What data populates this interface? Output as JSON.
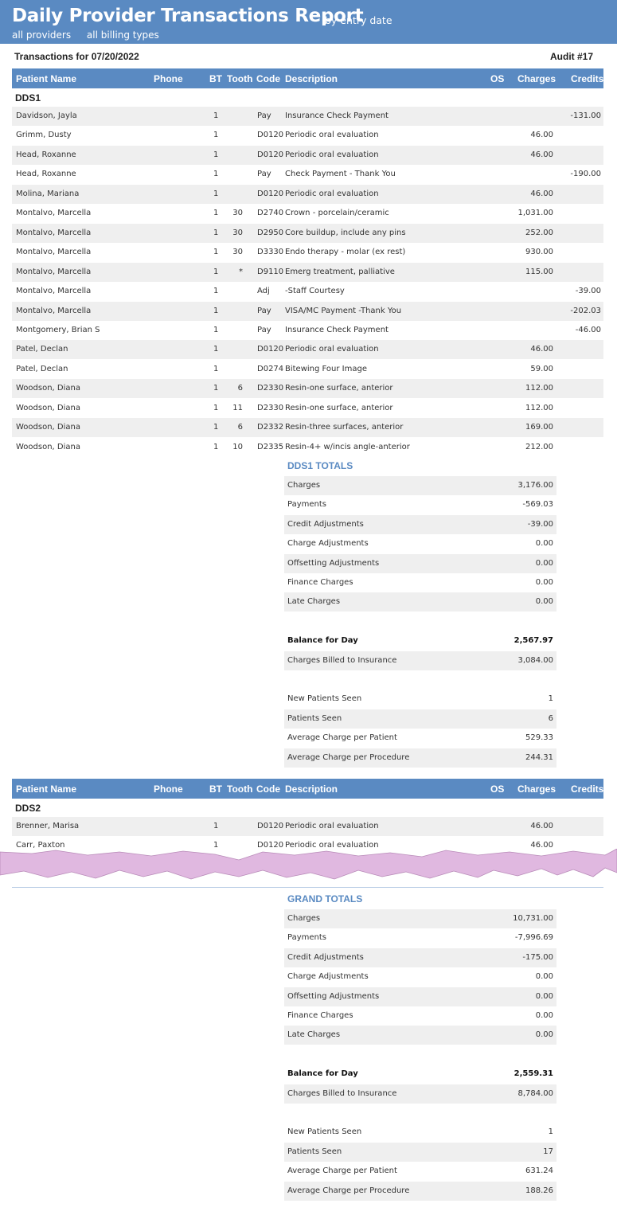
{
  "banner": {
    "title": "Daily Provider Transactions Report",
    "subtitle": "by entry date",
    "filter_providers": "all providers",
    "filter_billing": "all billing types"
  },
  "report": {
    "transactions_for": "Transactions for 07/20/2022",
    "audit": "Audit #17"
  },
  "columns": [
    "Patient Name",
    "Phone",
    "BT",
    "Tooth",
    "Code",
    "Description",
    "OS",
    "Charges",
    "Credits"
  ],
  "providers": [
    {
      "name": "DDS1",
      "rows": [
        {
          "name": "Davidson, Jayla",
          "bt": "1",
          "tooth": "",
          "code": "Pay",
          "desc": "Insurance Check Payment",
          "charges": "",
          "credits": "-131.00"
        },
        {
          "name": "Grimm, Dusty",
          "bt": "1",
          "tooth": "",
          "code": "D0120",
          "desc": "Periodic oral evaluation",
          "charges": "46.00",
          "credits": ""
        },
        {
          "name": "Head, Roxanne",
          "bt": "1",
          "tooth": "",
          "code": "D0120",
          "desc": "Periodic oral evaluation",
          "charges": "46.00",
          "credits": ""
        },
        {
          "name": "Head, Roxanne",
          "bt": "1",
          "tooth": "",
          "code": "Pay",
          "desc": "Check Payment - Thank You",
          "charges": "",
          "credits": "-190.00"
        },
        {
          "name": "Molina, Mariana",
          "bt": "1",
          "tooth": "",
          "code": "D0120",
          "desc": "Periodic oral evaluation",
          "charges": "46.00",
          "credits": ""
        },
        {
          "name": "Montalvo, Marcella",
          "bt": "1",
          "tooth": "30",
          "code": "D2740",
          "desc": "Crown - porcelain/ceramic",
          "charges": "1,031.00",
          "credits": ""
        },
        {
          "name": "Montalvo, Marcella",
          "bt": "1",
          "tooth": "30",
          "code": "D2950",
          "desc": "Core buildup, include any pins",
          "charges": "252.00",
          "credits": ""
        },
        {
          "name": "Montalvo, Marcella",
          "bt": "1",
          "tooth": "30",
          "code": "D3330",
          "desc": "Endo therapy - molar (ex rest)",
          "charges": "930.00",
          "credits": ""
        },
        {
          "name": "Montalvo, Marcella",
          "bt": "1",
          "tooth": "*",
          "code": "D9110",
          "desc": "Emerg treatment, palliative",
          "charges": "115.00",
          "credits": ""
        },
        {
          "name": "Montalvo, Marcella",
          "bt": "1",
          "tooth": "",
          "code": "Adj",
          "desc": "-Staff Courtesy",
          "charges": "",
          "credits": "-39.00"
        },
        {
          "name": "Montalvo, Marcella",
          "bt": "1",
          "tooth": "",
          "code": "Pay",
          "desc": "VISA/MC Payment -Thank You",
          "charges": "",
          "credits": "-202.03"
        },
        {
          "name": "Montgomery, Brian S",
          "bt": "1",
          "tooth": "",
          "code": "Pay",
          "desc": "Insurance Check Payment",
          "charges": "",
          "credits": "-46.00"
        },
        {
          "name": "Patel, Declan",
          "bt": "1",
          "tooth": "",
          "code": "D0120",
          "desc": "Periodic oral evaluation",
          "charges": "46.00",
          "credits": ""
        },
        {
          "name": "Patel, Declan",
          "bt": "1",
          "tooth": "",
          "code": "D0274",
          "desc": "Bitewing Four Image",
          "charges": "59.00",
          "credits": ""
        },
        {
          "name": "Woodson, Diana",
          "bt": "1",
          "tooth": "6",
          "code": "D2330",
          "desc": "Resin-one surface, anterior",
          "charges": "112.00",
          "credits": ""
        },
        {
          "name": "Woodson, Diana",
          "bt": "1",
          "tooth": "11",
          "code": "D2330",
          "desc": "Resin-one surface, anterior",
          "charges": "112.00",
          "credits": ""
        },
        {
          "name": "Woodson, Diana",
          "bt": "1",
          "tooth": "6",
          "code": "D2332",
          "desc": "Resin-three surfaces, anterior",
          "charges": "169.00",
          "credits": ""
        },
        {
          "name": "Woodson, Diana",
          "bt": "1",
          "tooth": "10",
          "code": "D2335",
          "desc": "Resin-4+ w/incis angle-anterior",
          "charges": "212.00",
          "credits": ""
        }
      ],
      "totals_title": "DDS1  TOTALS",
      "totals": {
        "charges": {
          "label": "Charges",
          "value": "3,176.00"
        },
        "payments": {
          "label": "Payments",
          "value": "-569.03"
        },
        "credit_adj": {
          "label": "Credit Adjustments",
          "value": "-39.00"
        },
        "charge_adj": {
          "label": "Charge Adjustments",
          "value": "0.00"
        },
        "offset_adj": {
          "label": "Offsetting Adjustments",
          "value": "0.00"
        },
        "finance": {
          "label": "Finance Charges",
          "value": "0.00"
        },
        "late": {
          "label": "Late Charges",
          "value": "0.00"
        },
        "balance": {
          "label": "Balance for Day",
          "value": "2,567.97"
        },
        "billed_ins": {
          "label": "Charges Billed to Insurance",
          "value": "3,084.00"
        },
        "new_patients": {
          "label": "New Patients Seen",
          "value": "1"
        },
        "patients_seen": {
          "label": "Patients Seen",
          "value": "6"
        },
        "avg_patient": {
          "label": "Average Charge per Patient",
          "value": "529.33"
        },
        "avg_procedure": {
          "label": "Average Charge per Procedure",
          "value": "244.31"
        }
      }
    },
    {
      "name": "DDS2",
      "rows": [
        {
          "name": "Brenner, Marisa",
          "bt": "1",
          "tooth": "",
          "code": "D0120",
          "desc": "Periodic oral evaluation",
          "charges": "46.00",
          "credits": ""
        },
        {
          "name": "Carr, Paxton",
          "bt": "1",
          "tooth": "",
          "code": "D0120",
          "desc": "Periodic oral evaluation",
          "charges": "46.00",
          "credits": ""
        }
      ]
    }
  ],
  "grand_totals": {
    "title": "GRAND TOTALS",
    "charges": {
      "label": "Charges",
      "value": "10,731.00"
    },
    "payments": {
      "label": "Payments",
      "value": "-7,996.69"
    },
    "credit_adj": {
      "label": "Credit Adjustments",
      "value": "-175.00"
    },
    "charge_adj": {
      "label": "Charge Adjustments",
      "value": "0.00"
    },
    "offset_adj": {
      "label": "Offsetting Adjustments",
      "value": "0.00"
    },
    "finance": {
      "label": "Finance Charges",
      "value": "0.00"
    },
    "late": {
      "label": "Late Charges",
      "value": "0.00"
    },
    "balance": {
      "label": "Balance for Day",
      "value": "2,559.31"
    },
    "billed_ins": {
      "label": "Charges Billed to Insurance",
      "value": "8,784.00"
    },
    "new_patients": {
      "label": "New Patients Seen",
      "value": "1"
    },
    "patients_seen": {
      "label": "Patients Seen",
      "value": "17"
    },
    "avg_patient": {
      "label": "Average Charge per Patient",
      "value": "631.24"
    },
    "avg_procedure": {
      "label": "Average Charge per Procedure",
      "value": "188.26"
    }
  },
  "colors": {
    "header_blue": "#5a8ac2",
    "row_alt": "#efefef",
    "torn_edge": "#e0b8e0"
  }
}
